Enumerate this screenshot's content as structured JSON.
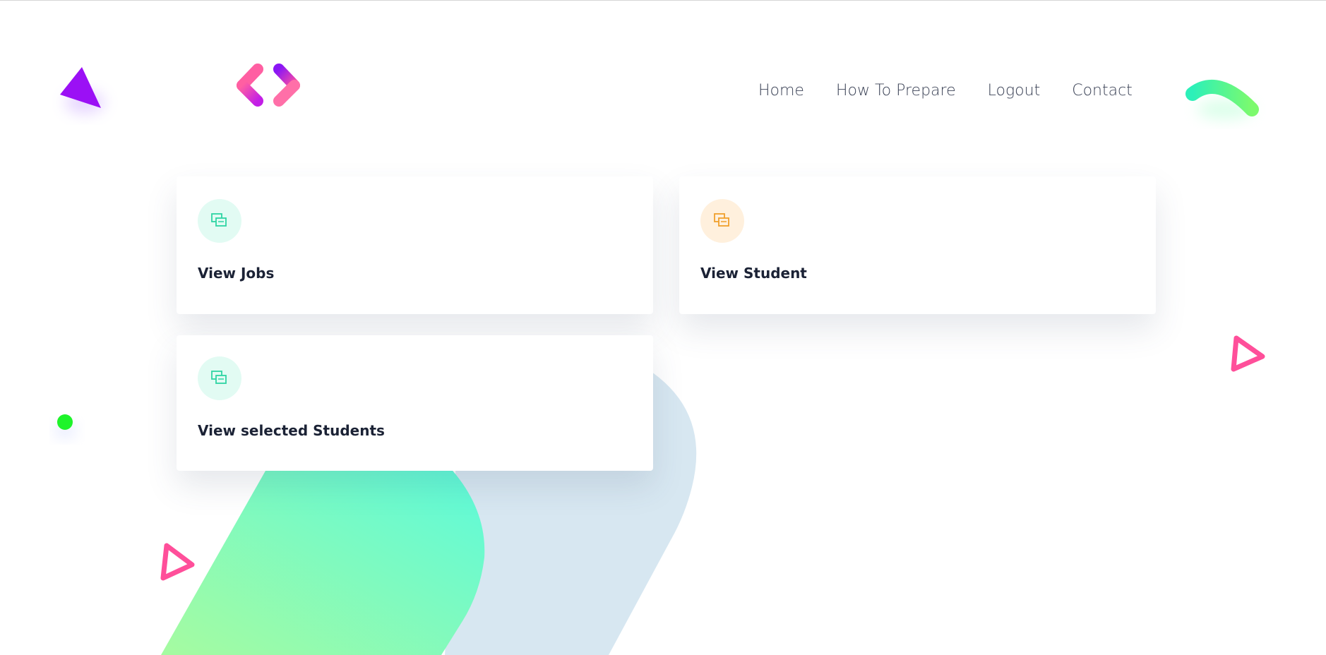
{
  "nav": {
    "items": [
      {
        "label": "Home"
      },
      {
        "label": "How To Prepare"
      },
      {
        "label": "Logout"
      },
      {
        "label": "Contact"
      }
    ]
  },
  "cards": [
    {
      "title": "View Jobs",
      "icon": "copy-icon",
      "icon_color": "#2fd5a3",
      "icon_bg": "#e2fbf3"
    },
    {
      "title": "View Student",
      "icon": "copy-icon",
      "icon_color": "#f0a02c",
      "icon_bg": "#fff0dd"
    },
    {
      "title": "View selected Students",
      "icon": "copy-icon",
      "icon_color": "#2fd5a3",
      "icon_bg": "#e2fbf3"
    }
  ],
  "colors": {
    "nav_text": "#3b4256",
    "card_title": "#1b2235",
    "accent_pink": "#ff4f9a",
    "accent_purple": "#9b10f5",
    "accent_green": "#45ee8e"
  }
}
